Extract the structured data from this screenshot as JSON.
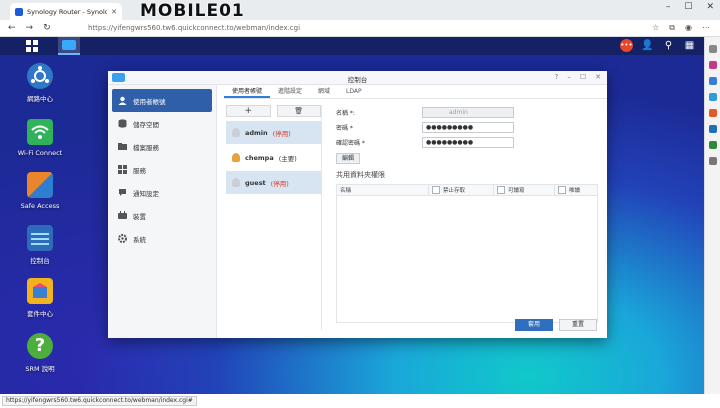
{
  "browser": {
    "tab_title": "Synology Router - Synology R...",
    "url": "https://yifengwrs560.tw6.quickconnect.to/webman/index.cgi",
    "status_url": "https://yifengwrs560.tw6.quickconnect.to/webman/index.cgi#",
    "watermark": "MOBILE01"
  },
  "desktop": {
    "icons": [
      {
        "label": "網路中心",
        "icon": "network-center-icon",
        "color": "#2f78c6"
      },
      {
        "label": "Wi-Fi Connect",
        "icon": "wifi-icon",
        "color": "#2fb25a"
      },
      {
        "label": "Safe Access",
        "icon": "safe-access-icon",
        "color": "#e9862b"
      },
      {
        "label": "控制台",
        "icon": "control-panel-icon",
        "color": "#2e6bb8"
      },
      {
        "label": "套件中心",
        "icon": "package-center-icon",
        "color": "#f2b31e"
      },
      {
        "label": "SRM 說明",
        "icon": "help-icon",
        "color": "#4cae3c"
      }
    ]
  },
  "window": {
    "title": "控制台",
    "sidebar": [
      {
        "label": "使用者帳號",
        "icon": "user-icon"
      },
      {
        "label": "儲存空間",
        "icon": "storage-icon"
      },
      {
        "label": "檔案服務",
        "icon": "file-services-icon"
      },
      {
        "label": "服務",
        "icon": "services-icon"
      },
      {
        "label": "通知設定",
        "icon": "notification-icon"
      },
      {
        "label": "裝置",
        "icon": "device-icon"
      },
      {
        "label": "系統",
        "icon": "system-gear-icon"
      }
    ],
    "tabs": [
      "使用者帳號",
      "進階設定",
      "網域",
      "LDAP"
    ],
    "user_buttons": {
      "add": "+",
      "delete": "🗑"
    },
    "users": [
      {
        "name": "admin",
        "status": "(停用)"
      },
      {
        "name": "chempa",
        "status": "(主要)"
      },
      {
        "name": "guest",
        "status": "(停用)"
      }
    ],
    "form": {
      "name_label": "名稱 *:",
      "name_value": "admin",
      "password_label": "密碼 *",
      "password_value": "●●●●●●●●●",
      "confirm_label": "確認密碼 *",
      "confirm_value": "●●●●●●●●●",
      "edit_button": "編輯"
    },
    "permissions": {
      "title": "共用資料夾權限",
      "columns": [
        "名稱",
        "禁止存取",
        "可讀寫",
        "唯讀"
      ]
    },
    "apply_button": "套用",
    "reset_button": "重置"
  }
}
